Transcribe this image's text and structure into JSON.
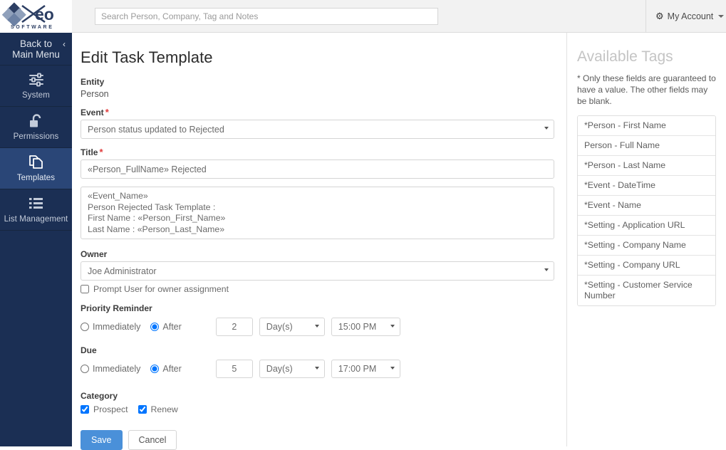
{
  "header": {
    "logo_text": "Xeo",
    "logo_sub": "S O F T W A R E",
    "search_placeholder": "Search Person, Company, Tag and Notes",
    "search_value": "",
    "account_label": "My Account",
    "gear_icon": "gear-icon",
    "caret_icon": "caret-down-icon"
  },
  "sidebar": {
    "back": {
      "line1": "Back to",
      "line2": "Main Menu",
      "chevron": "‹"
    },
    "items": [
      {
        "label": "System",
        "icon": "sliders-icon",
        "active": false
      },
      {
        "label": "Permissions",
        "icon": "unlock-icon",
        "active": false
      },
      {
        "label": "Templates",
        "icon": "copy-documents-icon",
        "active": true
      },
      {
        "label": "List Management",
        "icon": "list-icon",
        "active": false
      }
    ]
  },
  "main": {
    "title": "Edit Task Template",
    "entity": {
      "label": "Entity",
      "value": "Person"
    },
    "event": {
      "label": "Event",
      "required": "*",
      "value": "Person status updated to Rejected",
      "options": [
        "Person status updated to Rejected"
      ]
    },
    "title_field": {
      "label": "Title",
      "required": "*",
      "value": "«Person_FullName» Rejected",
      "placeholder": ""
    },
    "body": {
      "value": "«Event_Name»\nPerson Rejected Task Template :\nFirst Name : «Person_First_Name»\nLast Name : «Person_Last_Name»",
      "placeholder": ""
    },
    "owner": {
      "label": "Owner",
      "value": "Joe Administrator",
      "options": [
        "Joe Administrator"
      ],
      "prompt_label": "Prompt User for owner assignment",
      "prompt_checked": false
    },
    "priority_reminder": {
      "label": "Priority Reminder",
      "immediately_label": "Immediately",
      "after_label": "After",
      "selected": "After",
      "amount": "2",
      "unit": "Day(s)",
      "unit_options": [
        "Day(s)"
      ],
      "time": "15:00 PM",
      "time_options": [
        "15:00 PM"
      ]
    },
    "due": {
      "label": "Due",
      "immediately_label": "Immediately",
      "after_label": "After",
      "selected": "After",
      "amount": "5",
      "unit": "Day(s)",
      "unit_options": [
        "Day(s)"
      ],
      "time": "17:00 PM",
      "time_options": [
        "17:00 PM"
      ]
    },
    "category": {
      "label": "Category",
      "items": [
        {
          "label": "Prospect",
          "checked": true
        },
        {
          "label": "Renew",
          "checked": true
        }
      ]
    },
    "buttons": {
      "save": "Save",
      "cancel": "Cancel"
    }
  },
  "right_panel": {
    "title": "Available Tags",
    "note": "* Only these fields are guaranteed to have a value. The other fields may be blank.",
    "tags": [
      "*Person - First Name",
      "Person - Full Name",
      "*Person - Last Name",
      "*Event - DateTime",
      "*Event - Name",
      "*Setting - Application URL",
      "*Setting - Company Name",
      "*Setting - Company URL",
      "*Setting - Customer Service Number"
    ]
  },
  "colors": {
    "sidebar_bg": "#1b2f54",
    "sidebar_active": "#2a4677",
    "topbar_bg": "#f2f2f2",
    "primary_button": "#4a90d9",
    "required_star": "#e03b3b"
  }
}
